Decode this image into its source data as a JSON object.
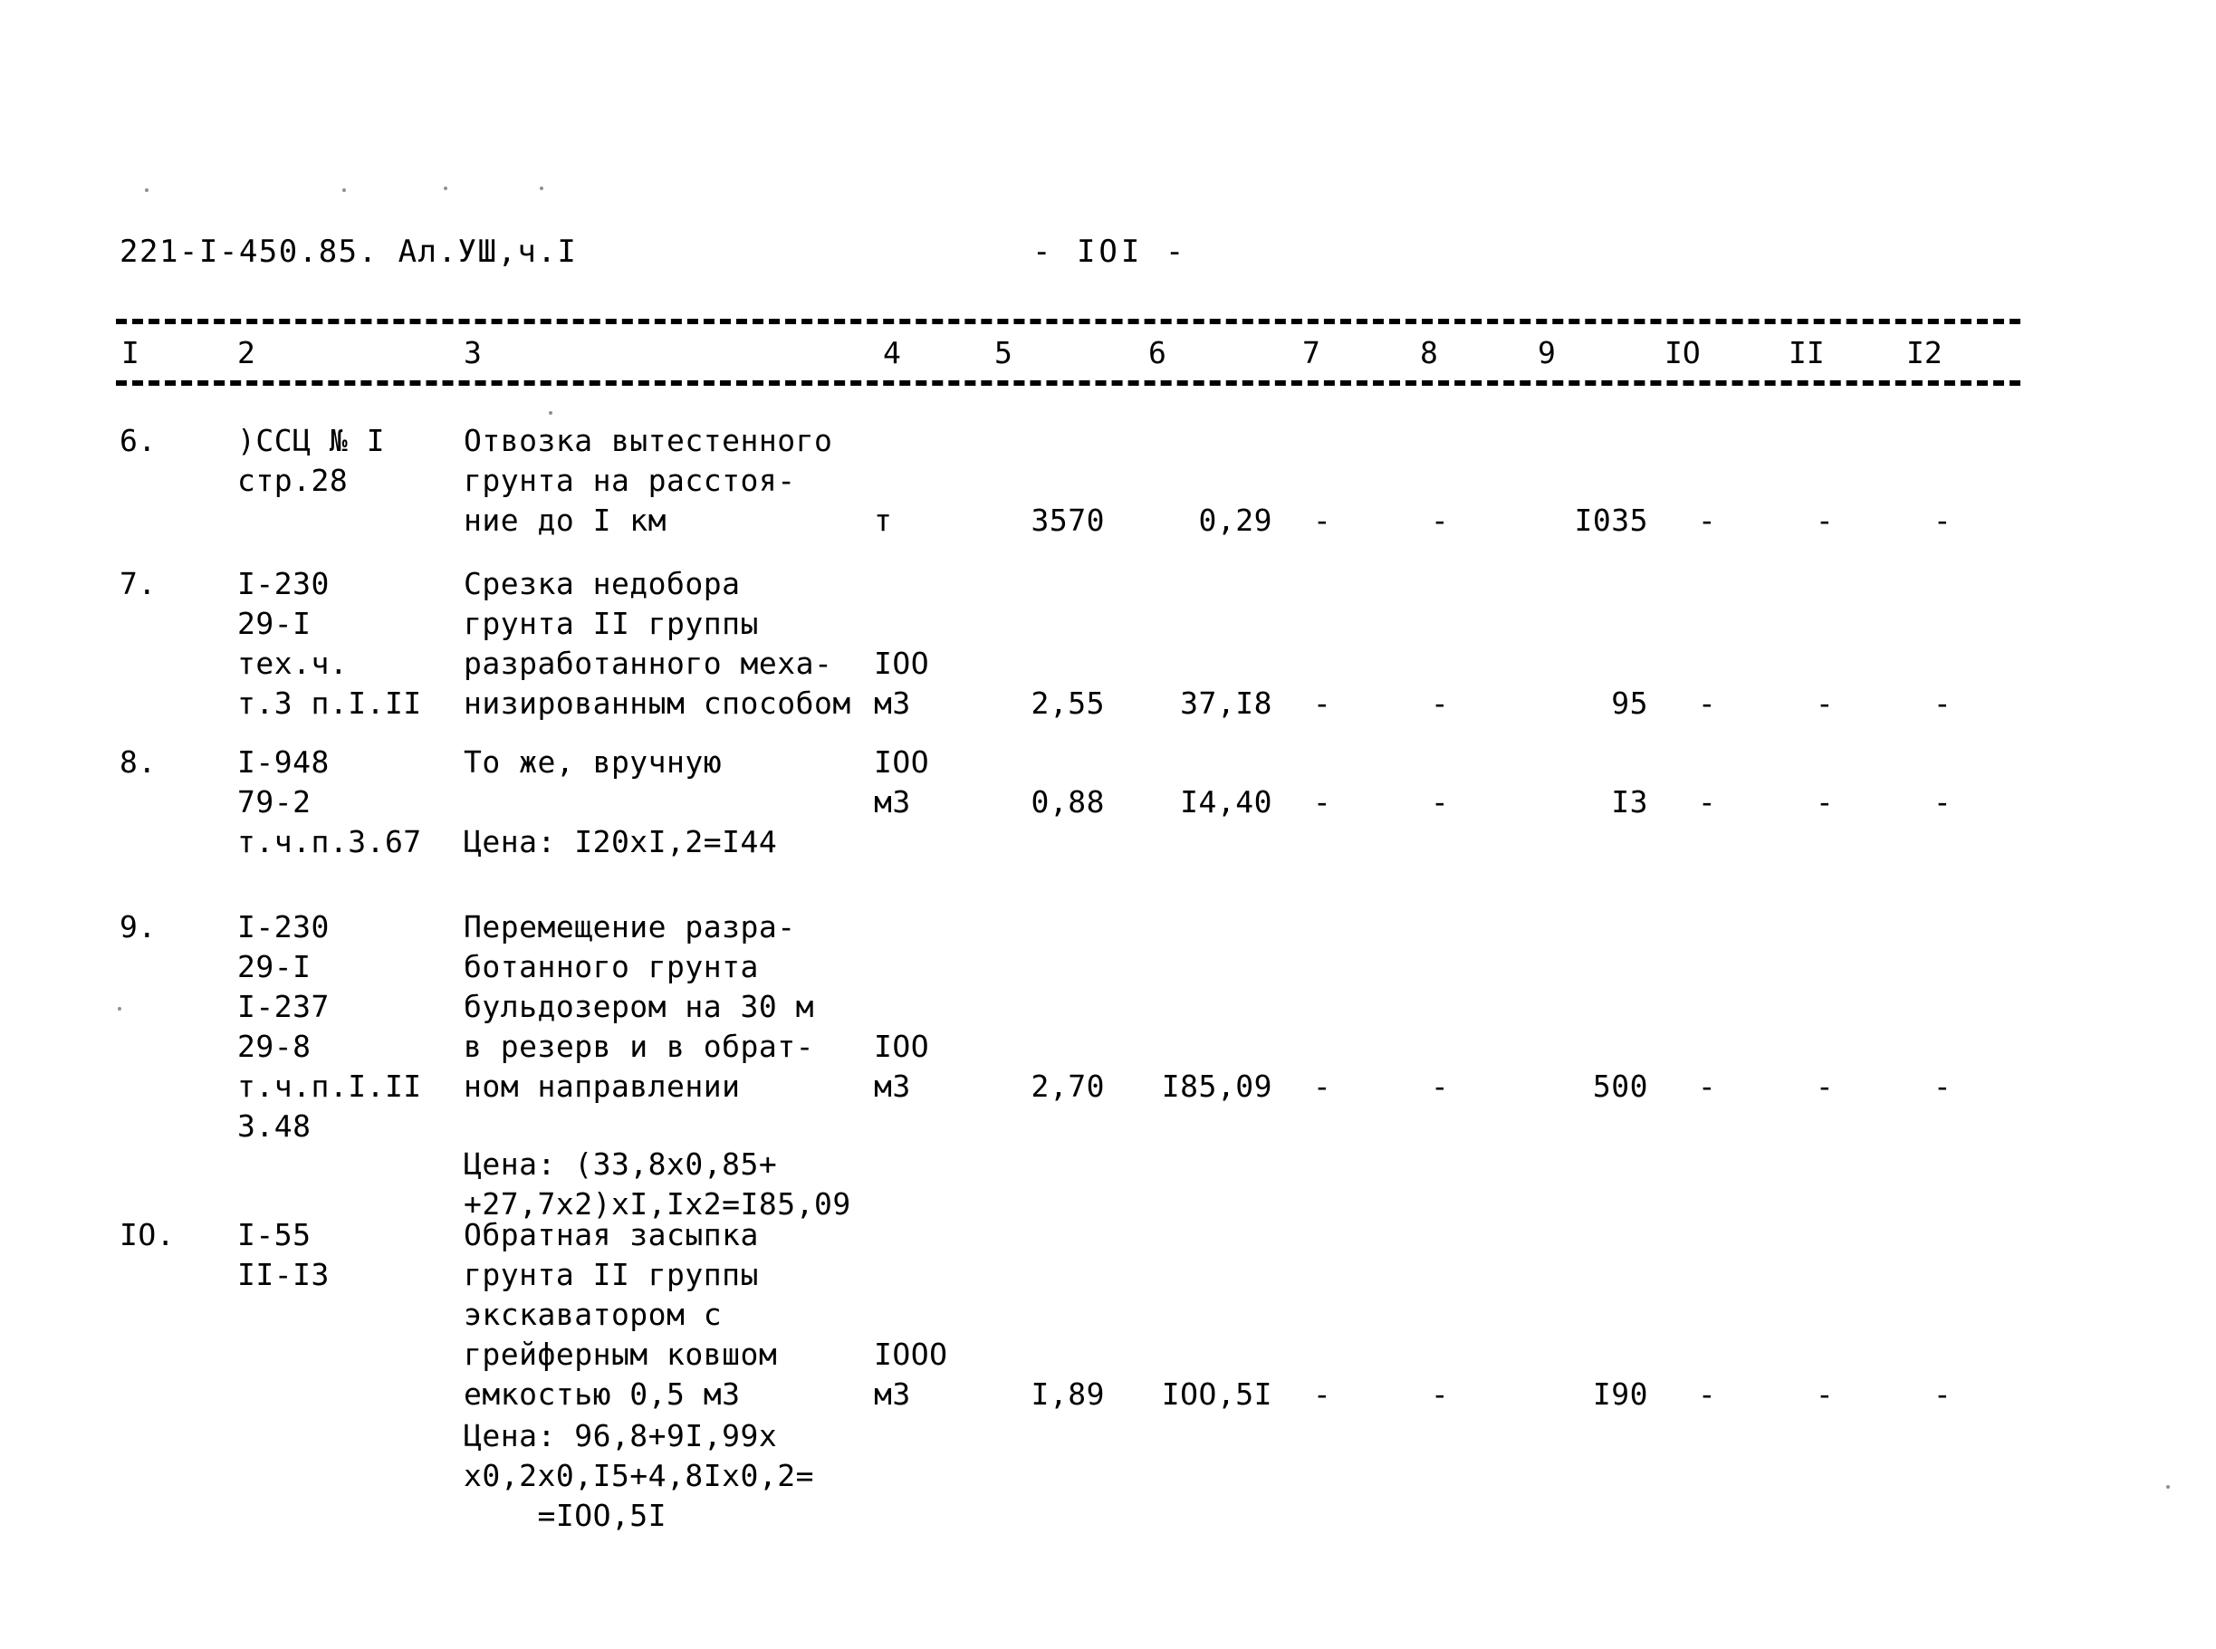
{
  "document": {
    "header_left": "221-I-450.85. Ал.УШ,ч.I",
    "page_number": "-  IOI  -"
  },
  "table": {
    "column_headers": [
      "I",
      "2",
      "3",
      "4",
      "5",
      "6",
      "7",
      "8",
      "9",
      "IO",
      "II",
      "I2"
    ],
    "rows": [
      {
        "num": "6.",
        "code": ")ССЦ № I\nстр.28",
        "desc": "Отвозка вытестенного\nгрунта на расстоя-\nние до I км",
        "unit": "т",
        "c5": "3570",
        "c6": "0,29",
        "c7": "-",
        "c8": "-",
        "c9": "I035",
        "c10": "-",
        "c11": "-",
        "c12": "-",
        "note": ""
      },
      {
        "num": "7.",
        "code": "I-230\n29-I\nтех.ч.\nт.3 п.I.II",
        "desc": "Срезка недобора\nгрунта II группы\nразработанного меха-\nнизированным способом",
        "unit": "IOO\nм3",
        "c5": "2,55",
        "c6": "37,I8",
        "c7": "-",
        "c8": "-",
        "c9": "95",
        "c10": "-",
        "c11": "-",
        "c12": "-",
        "note": ""
      },
      {
        "num": "8.",
        "code": "I-948\n79-2\nт.ч.п.3.67",
        "desc": "То же, вручную",
        "unit": "IOO\nм3",
        "c5": "0,88",
        "c6": "I4,40",
        "c7": "-",
        "c8": "-",
        "c9": "I3",
        "c10": "-",
        "c11": "-",
        "c12": "-",
        "note": "Цена: I20xI,2=I44"
      },
      {
        "num": "9.",
        "code": "I-230\n29-I\nI-237\n29-8\nт.ч.п.I.II\n3.48",
        "desc": "Перемещение разра-\nботанного грунта\nбульдозером на 30 м\nв резерв и в обрат-\nном направлении",
        "unit": "IOO\nм3",
        "c5": "2,70",
        "c6": "I85,09",
        "c7": "-",
        "c8": "-",
        "c9": "500",
        "c10": "-",
        "c11": "-",
        "c12": "-",
        "note": "Цена: (33,8x0,85+\n+27,7x2)xI,Ix2=I85,09"
      },
      {
        "num": "IO.",
        "code": "I-55\nII-I3",
        "desc": "Обратная засыпка\nгрунта II группы\nэкскаватором с\nгрейферным ковшом\nемкостью 0,5 м3",
        "unit": "IOOO\nм3",
        "c5": "I,89",
        "c6": "IOO,5I",
        "c7": "-",
        "c8": "-",
        "c9": "I90",
        "c10": "-",
        "c11": "-",
        "c12": "-",
        "note": "Цена: 96,8+9I,99x\nx0,2x0,I5+4,8Ix0,2=\n    =IOO,5I"
      }
    ]
  }
}
